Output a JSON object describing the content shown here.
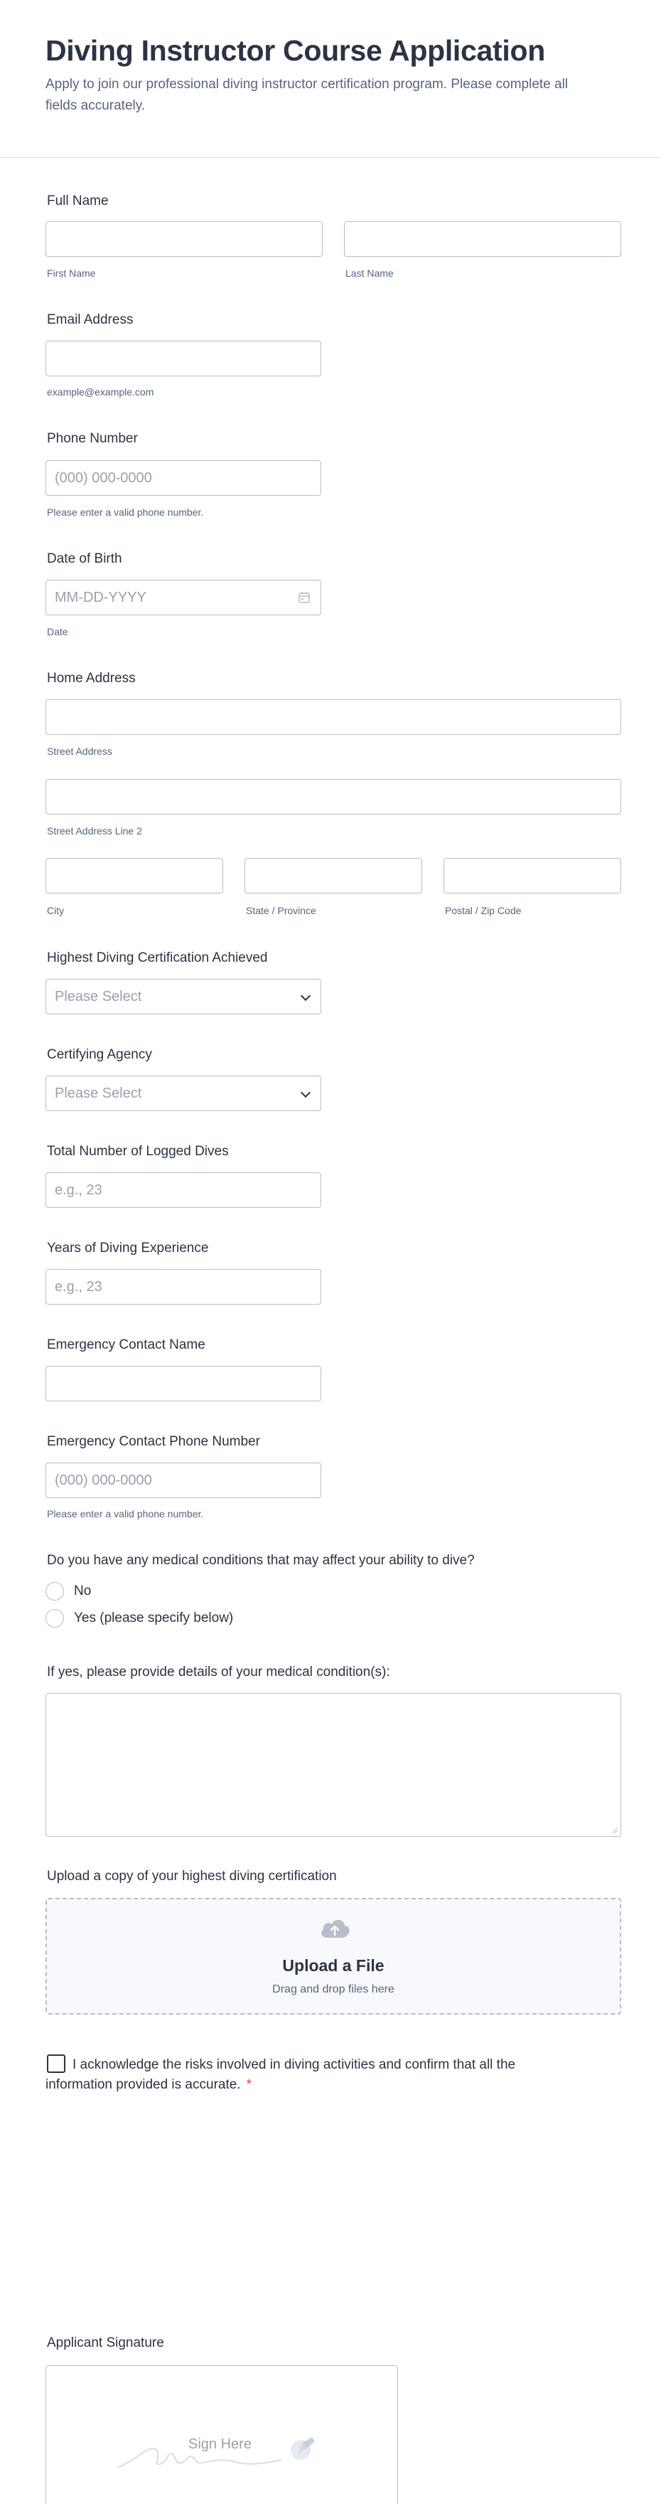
{
  "form": {
    "title": "Diving Instructor Course Application",
    "subtitle": "Apply to join our professional diving instructor certification program. Please complete all fields accurately."
  },
  "full_name": {
    "label": "Full Name",
    "first_sub": "First Name",
    "last_sub": "Last Name"
  },
  "email": {
    "label": "Email Address",
    "sub": "example@example.com"
  },
  "phone": {
    "label": "Phone Number",
    "placeholder": "(000) 000-0000",
    "sub": "Please enter a valid phone number."
  },
  "dob": {
    "label": "Date of Birth",
    "placeholder": "MM-DD-YYYY",
    "sub": "Date",
    "icon": "calendar-icon"
  },
  "address": {
    "label": "Home Address",
    "street_sub": "Street Address",
    "street2_sub": "Street Address Line 2",
    "city_sub": "City",
    "state_sub": "State / Province",
    "zip_sub": "Postal / Zip Code"
  },
  "certification": {
    "label": "Highest Diving Certification Achieved",
    "selected": "Please Select"
  },
  "agency": {
    "label": "Certifying Agency",
    "selected": "Please Select"
  },
  "logged_dives": {
    "label": "Total Number of Logged Dives",
    "placeholder": "e.g., 23"
  },
  "experience": {
    "label": "Years of Diving Experience",
    "placeholder": "e.g., 23"
  },
  "emergency_name": {
    "label": "Emergency Contact Name"
  },
  "emergency_phone": {
    "label": "Emergency Contact Phone Number",
    "placeholder": "(000) 000-0000",
    "sub": "Please enter a valid phone number."
  },
  "medical": {
    "label": "Do you have any medical conditions that may affect your ability to dive?",
    "options": [
      "No",
      "Yes (please specify below)"
    ]
  },
  "medical_details": {
    "label": "If yes, please provide details of your medical condition(s):"
  },
  "upload": {
    "label": "Upload a copy of your highest diving certification",
    "title": "Upload a File",
    "subtitle": "Drag and drop files here",
    "icon": "cloud-upload-icon"
  },
  "acknowledge": {
    "text": "I acknowledge the risks involved in diving activities and confirm that all the information provided is accurate.",
    "required_mark": "*"
  },
  "signature": {
    "label": "Applicant Signature",
    "placeholder": "Sign Here",
    "icon": "pen-icon"
  },
  "colors": {
    "text": "#2c3345",
    "muted": "#57647e",
    "border": "#b8bdc9",
    "required": "#f23a3c",
    "upload_bg": "#f8f9fd"
  }
}
